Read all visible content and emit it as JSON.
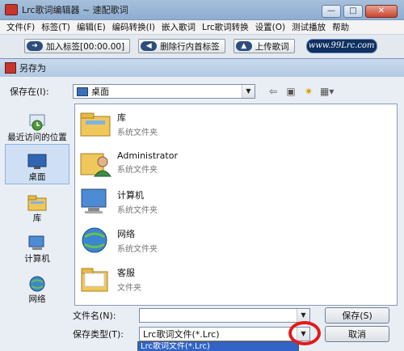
{
  "app": {
    "title": "Lrc歌词编辑器 ~ 速配歌词",
    "menu": [
      "文件(F)",
      "标签(T)",
      "编辑(E)",
      "编码转换(I)",
      "嵌入歌词",
      "Lrc歌词转换",
      "设置(O)",
      "测试播放",
      "帮助"
    ],
    "toolbar": {
      "add_tag": "加入标签[00:00.00]",
      "delete_tag": "删除行内首标签",
      "upload": "上传歌词",
      "logo": "www.99Lrc.com"
    }
  },
  "dialog": {
    "title": "另存为",
    "save_in_label": "保存在(I):",
    "save_in_value": "桌面",
    "places": [
      {
        "label": "最近访问的位置"
      },
      {
        "label": "桌面"
      },
      {
        "label": "库"
      },
      {
        "label": "计算机"
      },
      {
        "label": "网络"
      }
    ],
    "files": [
      {
        "name": "库",
        "type": "系统文件夹"
      },
      {
        "name": "Administrator",
        "type": "系统文件夹"
      },
      {
        "name": "计算机",
        "type": "系统文件夹"
      },
      {
        "name": "网络",
        "type": "系统文件夹"
      },
      {
        "name": "客服",
        "type": "文件夹"
      }
    ],
    "filename_label": "文件名(N):",
    "filename_value": "",
    "filetype_label": "保存类型(T):",
    "filetype_value": "Lrc歌词文件(*.Lrc)",
    "save_button": "保存(S)",
    "cancel_button": "取消",
    "dropdown_option": "Lrc歌词文件(*.Lrc)"
  }
}
